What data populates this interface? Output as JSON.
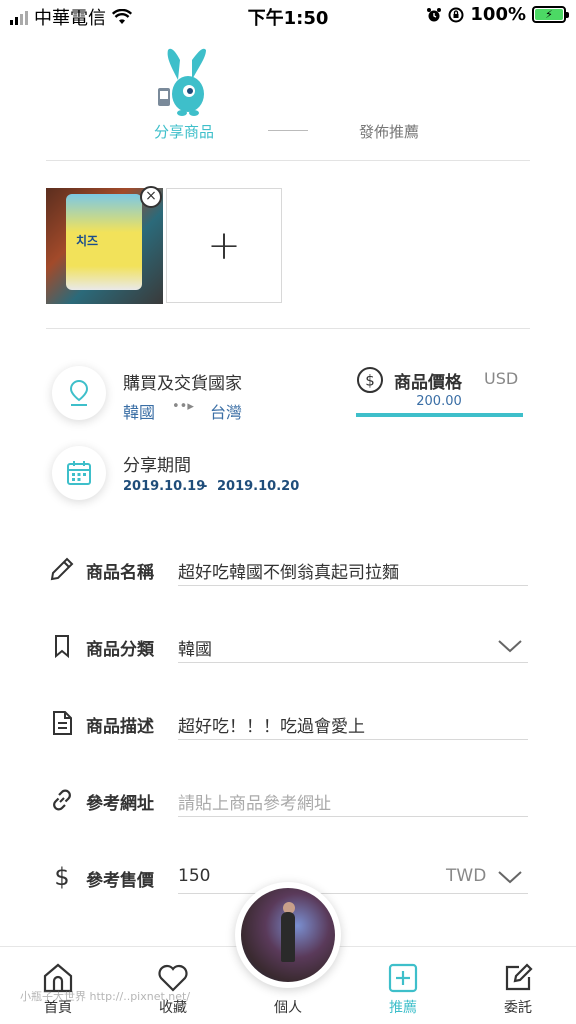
{
  "status_bar": {
    "carrier": "中華電信",
    "time": "下午1:50",
    "battery": "100%"
  },
  "steps": {
    "step1": "分享商品",
    "step2": "發佈推薦"
  },
  "info": {
    "country_title": "購買及交貨國家",
    "country_from": "韓國",
    "country_to": "台灣",
    "period_title": "分享期間",
    "period_start": "2019.10.19",
    "period_sep": "-",
    "period_end": "2019.10.20",
    "price_label": "商品價格",
    "price_currency": "USD",
    "price_value": "200.00",
    "route_arrow": "••▸"
  },
  "photo": {
    "pack_text": "치즈"
  },
  "form": {
    "name": {
      "label": "商品名稱",
      "value": "超好吃韓國不倒翁真起司拉麵"
    },
    "category": {
      "label": "商品分類",
      "value": "韓國"
    },
    "description": {
      "label": "商品描述",
      "value": "超好吃！！！吃過會愛上"
    },
    "url": {
      "label": "參考網址",
      "placeholder": "請貼上商品參考網址"
    },
    "ref_price": {
      "label": "參考售價",
      "value": "150",
      "currency": "TWD"
    }
  },
  "nav": {
    "home": "首頁",
    "favorites": "收藏",
    "profile": "個人",
    "recommend": "推薦",
    "commission": "委託"
  },
  "watermark": "小瓶子大世界 http://..pixnet.net/",
  "colors": {
    "accent": "#3ebfca",
    "link_blue": "#3a6ea5",
    "battery_green": "#4cd964"
  }
}
